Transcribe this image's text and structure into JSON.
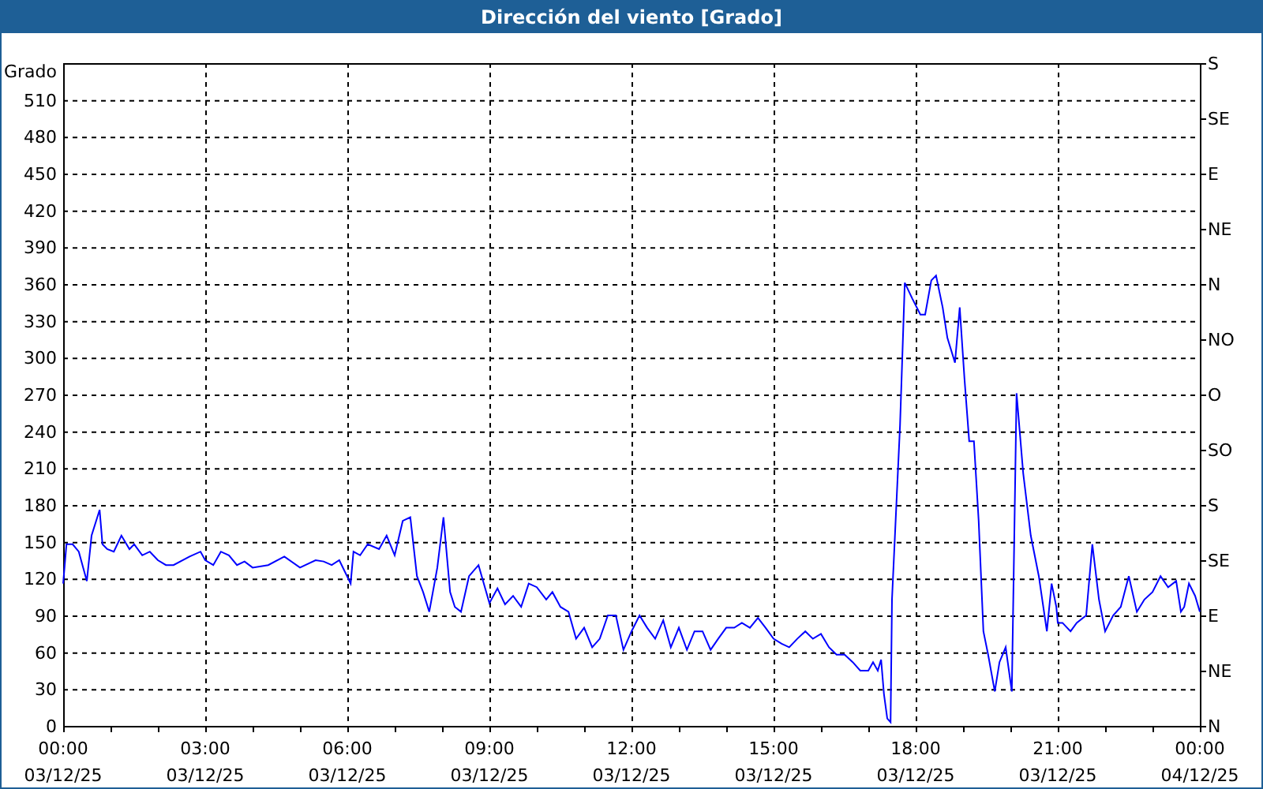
{
  "window": {
    "title": "Dirección del viento [Grado]"
  },
  "chart": {
    "chart_data": {
      "type": "line",
      "grid": true,
      "ylabel": "Grado",
      "xlim": [
        0,
        24
      ],
      "ylim": [
        0,
        540
      ],
      "xticks": [
        {
          "value": 0,
          "label": "00:00"
        },
        {
          "value": 3,
          "label": "03:00"
        },
        {
          "value": 6,
          "label": "06:00"
        },
        {
          "value": 9,
          "label": "09:00"
        },
        {
          "value": 12,
          "label": "12:00"
        },
        {
          "value": 15,
          "label": "15:00"
        },
        {
          "value": 18,
          "label": "18:00"
        },
        {
          "value": 21,
          "label": "21:00"
        },
        {
          "value": 24,
          "label": "00:00"
        }
      ],
      "yticks": [
        0,
        30,
        60,
        90,
        120,
        150,
        180,
        210,
        240,
        270,
        300,
        330,
        360,
        390,
        420,
        450,
        480,
        510
      ],
      "x": [
        0,
        0.07,
        0.2,
        0.33,
        0.5,
        0.6,
        0.77,
        0.83,
        0.93,
        1.07,
        1.23,
        1.4,
        1.5,
        1.67,
        1.83,
        2,
        2.17,
        2.33,
        2.67,
        2.9,
        3,
        3.17,
        3.33,
        3.5,
        3.67,
        3.83,
        4,
        4.33,
        4.67,
        5,
        5.33,
        5.5,
        5.67,
        5.83,
        6.07,
        6.13,
        6.27,
        6.43,
        6.67,
        6.83,
        7,
        7.17,
        7.33,
        7.47,
        7.6,
        7.73,
        7.9,
        8.03,
        8.17,
        8.27,
        8.4,
        8.57,
        8.77,
        9,
        9.17,
        9.33,
        9.5,
        9.67,
        9.83,
        10,
        10.2,
        10.33,
        10.5,
        10.67,
        10.83,
        11,
        11.17,
        11.33,
        11.5,
        11.67,
        11.83,
        12,
        12.17,
        12.33,
        12.5,
        12.67,
        12.83,
        13,
        13.17,
        13.33,
        13.5,
        13.67,
        13.83,
        14,
        14.17,
        14.33,
        14.5,
        14.67,
        14.83,
        15,
        15.17,
        15.33,
        15.5,
        15.67,
        15.83,
        16,
        16.17,
        16.33,
        16.5,
        16.67,
        16.83,
        17,
        17.1,
        17.2,
        17.27,
        17.33,
        17.4,
        17.47,
        17.5,
        17.67,
        17.77,
        17.93,
        18.1,
        18.2,
        18.33,
        18.43,
        18.57,
        18.67,
        18.83,
        18.93,
        19.03,
        19.13,
        19.23,
        19.33,
        19.43,
        19.53,
        19.67,
        19.77,
        19.9,
        20.03,
        20.13,
        20.27,
        20.43,
        20.6,
        20.77,
        20.87,
        20.97,
        21,
        21.1,
        21.27,
        21.4,
        21.6,
        21.73,
        21.87,
        22,
        22.17,
        22.33,
        22.5,
        22.67,
        22.83,
        23,
        23.17,
        23.33,
        23.5,
        23.6,
        23.67,
        23.77,
        23.9,
        24
      ],
      "series": [
        {
          "color": "#0000ff",
          "values": [
            116,
            148,
            148,
            142,
            118,
            155,
            176,
            148,
            144,
            142,
            155,
            144,
            148,
            139,
            142,
            135,
            131,
            131,
            138,
            142,
            135,
            131,
            142,
            139,
            131,
            134,
            129,
            131,
            138,
            129,
            135,
            134,
            131,
            135,
            116,
            142,
            139,
            148,
            144,
            155,
            139,
            167,
            170,
            122,
            109,
            93,
            129,
            170,
            109,
            97,
            93,
            122,
            131,
            100,
            112,
            99,
            106,
            97,
            116,
            113,
            103,
            109,
            97,
            93,
            71,
            80,
            64,
            71,
            90,
            90,
            62,
            77,
            90,
            80,
            71,
            86,
            64,
            80,
            62,
            77,
            77,
            62,
            71,
            80,
            80,
            84,
            80,
            88,
            80,
            71,
            67,
            64,
            71,
            77,
            71,
            75,
            64,
            58,
            58,
            52,
            45,
            45,
            52,
            45,
            54,
            26,
            6,
            3,
            103,
            245,
            361,
            348,
            335,
            335,
            363,
            367,
            341,
            316,
            296,
            341,
            283,
            232,
            232,
            167,
            77,
            58,
            28,
            52,
            64,
            28,
            271,
            206,
            155,
            122,
            77,
            116,
            97,
            84,
            84,
            77,
            84,
            90,
            148,
            103,
            77,
            90,
            97,
            122,
            93,
            103,
            109,
            122,
            113,
            118,
            93,
            97,
            116,
            106,
            93
          ]
        }
      ]
    },
    "direction_labels": [
      "S",
      "SE",
      "E",
      "NE",
      "N",
      "NO",
      "O",
      "SO",
      "S",
      "SE",
      "E",
      "NE",
      "N"
    ],
    "date_labels": [
      "03/12/25",
      "03/12/25",
      "03/12/25",
      "03/12/25",
      "03/12/25",
      "03/12/25",
      "03/12/25",
      "03/12/25",
      "04/12/25"
    ]
  }
}
